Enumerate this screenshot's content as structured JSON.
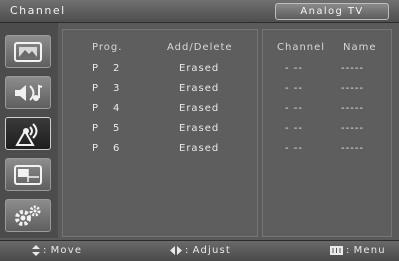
{
  "header": {
    "title": "Channel",
    "mode_badge": "Analog TV"
  },
  "sidebar": {
    "items": [
      {
        "icon": "picture-icon",
        "active": false
      },
      {
        "icon": "sound-icon",
        "active": false
      },
      {
        "icon": "channel-icon",
        "active": true
      },
      {
        "icon": "setup-window-icon",
        "active": false
      },
      {
        "icon": "settings-gears-icon",
        "active": false
      }
    ]
  },
  "table": {
    "headers": {
      "prog": "Prog.",
      "add_delete": "Add/Delete",
      "channel": "Channel",
      "name": "Name"
    },
    "rows": [
      {
        "prefix": "P",
        "num": "2",
        "status": "Erased",
        "channel": "- --",
        "name": "-----"
      },
      {
        "prefix": "P",
        "num": "3",
        "status": "Erased",
        "channel": "- --",
        "name": "-----"
      },
      {
        "prefix": "P",
        "num": "4",
        "status": "Erased",
        "channel": "- --",
        "name": "-----"
      },
      {
        "prefix": "P",
        "num": "5",
        "status": "Erased",
        "channel": "- --",
        "name": "-----"
      },
      {
        "prefix": "P",
        "num": "6",
        "status": "Erased",
        "channel": "- --",
        "name": "-----"
      }
    ]
  },
  "footer": {
    "move": "Move",
    "adjust": "Adjust",
    "menu": "Menu",
    "separator": ":"
  },
  "colors": {
    "background": "#5a5a5a",
    "active_icon_bg": "#2a2a2a",
    "text": "#eaeaea"
  }
}
